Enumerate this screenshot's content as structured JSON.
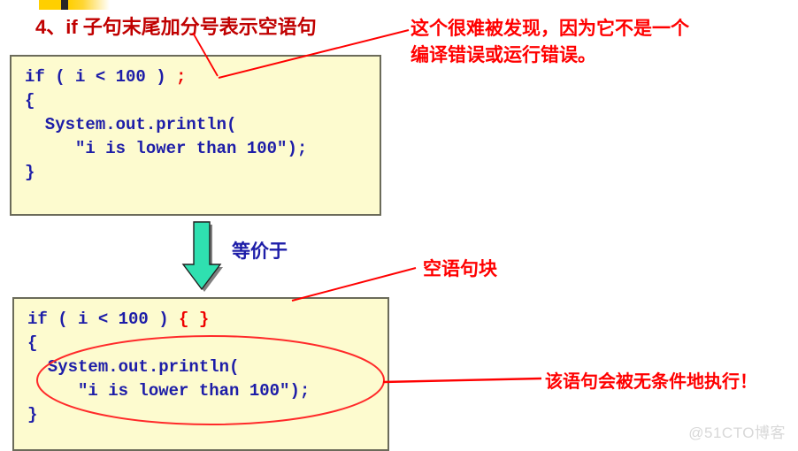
{
  "slide": {
    "title": "4、if 子句末尾加分号表示空语句",
    "watermark": "@51CTO博客"
  },
  "code_box_1": {
    "lines": [
      "if ( i < 100 ) ",
      "{",
      "  System.out.println(",
      "     \"i is lower than 100\");",
      "}"
    ],
    "highlight": ";",
    "highlight_color": "#ee0000",
    "text_color": "#1d1da8",
    "background": "#fdfbcf",
    "border_color": "#6b6b5a"
  },
  "code_box_2": {
    "line1_prefix": "if ( i < 100 ) ",
    "line1_highlight": "{ }",
    "lines_rest": [
      "{",
      "  System.out.println(",
      "     \"i is lower than 100\");",
      "}"
    ],
    "highlight_color": "#ee0000",
    "text_color": "#1d1da8",
    "background": "#fdfbcf",
    "border_color": "#6b6b5a"
  },
  "arrow": {
    "label": "等价于",
    "label_color": "#1d1da8",
    "fill": "#2fe0b0",
    "shadow": "#808080"
  },
  "annotations": {
    "hard_to_find_line1": "这个很难被发现，因为它不是一个",
    "hard_to_find_line2": "编译错误或运行错误。",
    "empty_block": "空语句块",
    "unconditional": "该语句会被无条件地执行！",
    "color": "#ff0000"
  },
  "decor": {
    "top_bar_colors": [
      "#ffcf00",
      "#262626",
      "#ffffff"
    ]
  }
}
